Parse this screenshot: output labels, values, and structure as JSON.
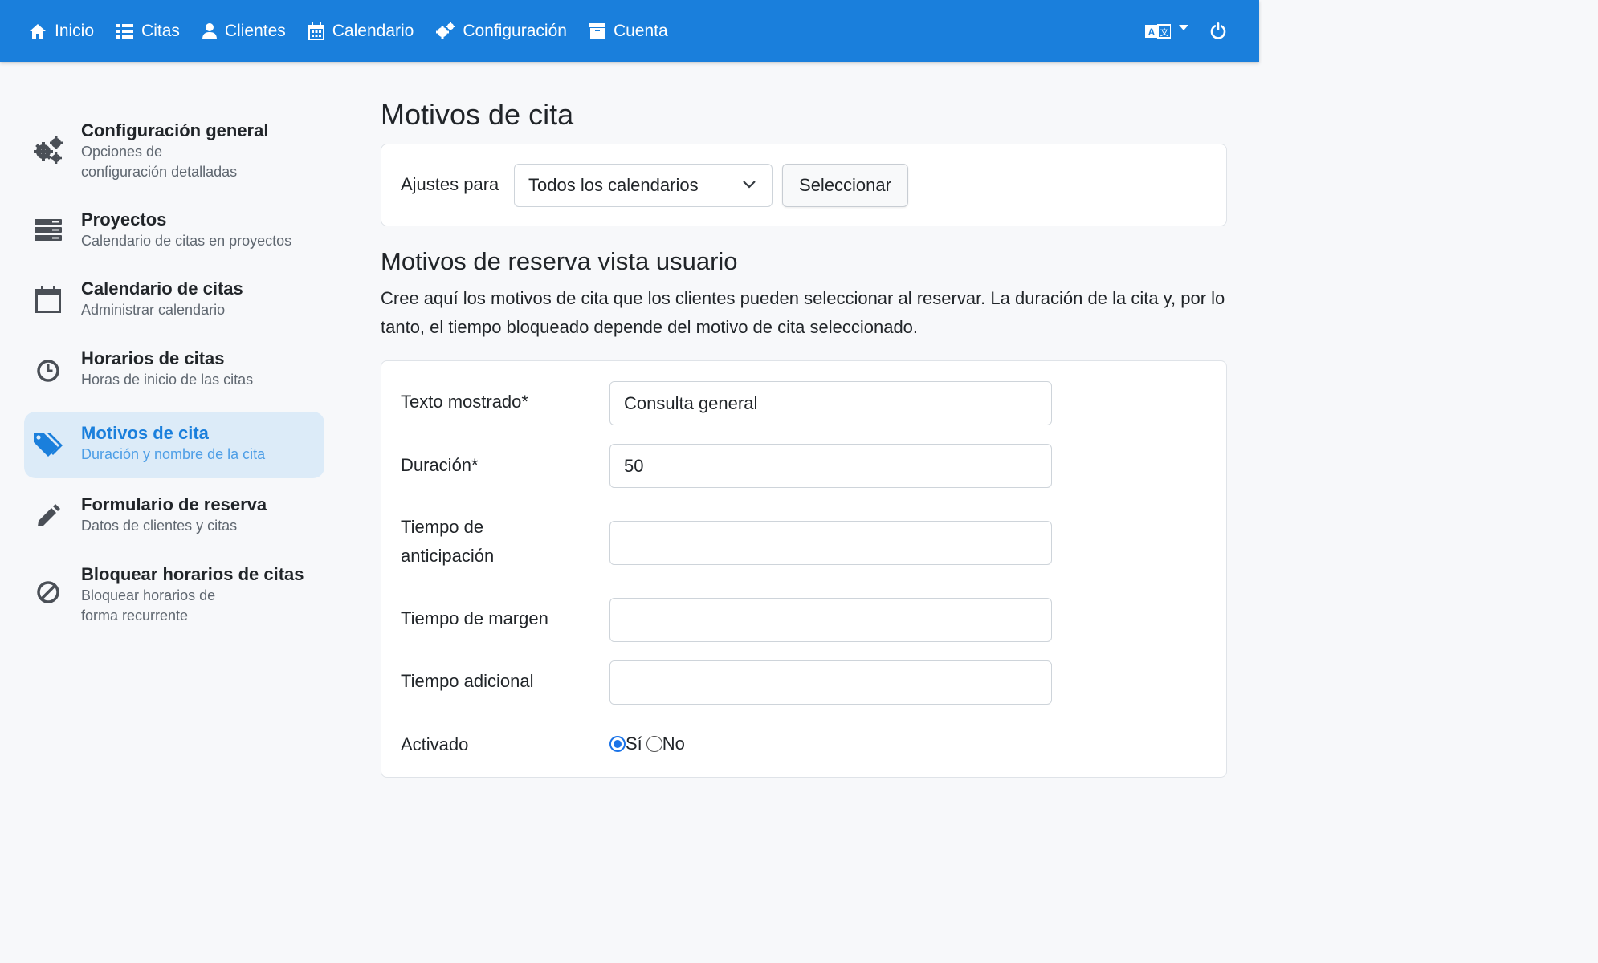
{
  "navbar": {
    "items": [
      {
        "label": "Inicio",
        "icon": "home-icon"
      },
      {
        "label": "Citas",
        "icon": "list-icon"
      },
      {
        "label": "Clientes",
        "icon": "user-icon"
      },
      {
        "label": "Calendario",
        "icon": "calendar-icon"
      },
      {
        "label": "Configuración",
        "icon": "gears-icon"
      },
      {
        "label": "Cuenta",
        "icon": "archive-icon"
      }
    ],
    "color": "#1a7fdc"
  },
  "sidebar": {
    "items": [
      {
        "title": "Configuración general",
        "subtitle": "Opciones de configuración detalladas",
        "icon": "gears-icon",
        "active": false
      },
      {
        "title": "Proyectos",
        "subtitle": "Calendario de citas en proyectos",
        "icon": "server-icon",
        "active": false
      },
      {
        "title": "Calendario de citas",
        "subtitle": "Administrar calendario",
        "icon": "calendar-icon",
        "active": false
      },
      {
        "title": "Horarios de citas",
        "subtitle": "Horas de inicio de las citas",
        "icon": "clock-icon",
        "active": false
      },
      {
        "title": "Motivos de cita",
        "subtitle": "Duración y nombre de la cita",
        "icon": "tags-icon",
        "active": true
      },
      {
        "title": "Formulario de reserva",
        "subtitle": "Datos de clientes y citas",
        "icon": "pencil-icon",
        "active": false
      },
      {
        "title": "Bloquear horarios de citas",
        "subtitle": "Bloquear horarios de forma recurrente",
        "icon": "ban-icon",
        "active": false
      }
    ]
  },
  "main": {
    "title": "Motivos de cita",
    "settings": {
      "label": "Ajustes para",
      "select_value": "Todos los calendarios",
      "button_label": "Seleccionar"
    },
    "section": {
      "title": "Motivos de reserva vista usuario",
      "description": "Cree aquí los motivos de cita que los clientes pueden seleccionar al reservar. La duración de la cita y, por lo tanto, el tiempo bloqueado depende del motivo de cita seleccionado."
    },
    "form": {
      "display_text": {
        "label": "Texto mostrado*",
        "value": "Consulta general"
      },
      "duration": {
        "label": "Duración*",
        "value": "50"
      },
      "lead_time": {
        "label": "Tiempo de anticipación",
        "value": ""
      },
      "margin_time": {
        "label": "Tiempo de margen",
        "value": ""
      },
      "additional_time": {
        "label": "Tiempo adicional",
        "value": ""
      },
      "active": {
        "label": "Activado",
        "yes_label": "Sí",
        "no_label": "No",
        "selected": "Sí"
      }
    }
  }
}
